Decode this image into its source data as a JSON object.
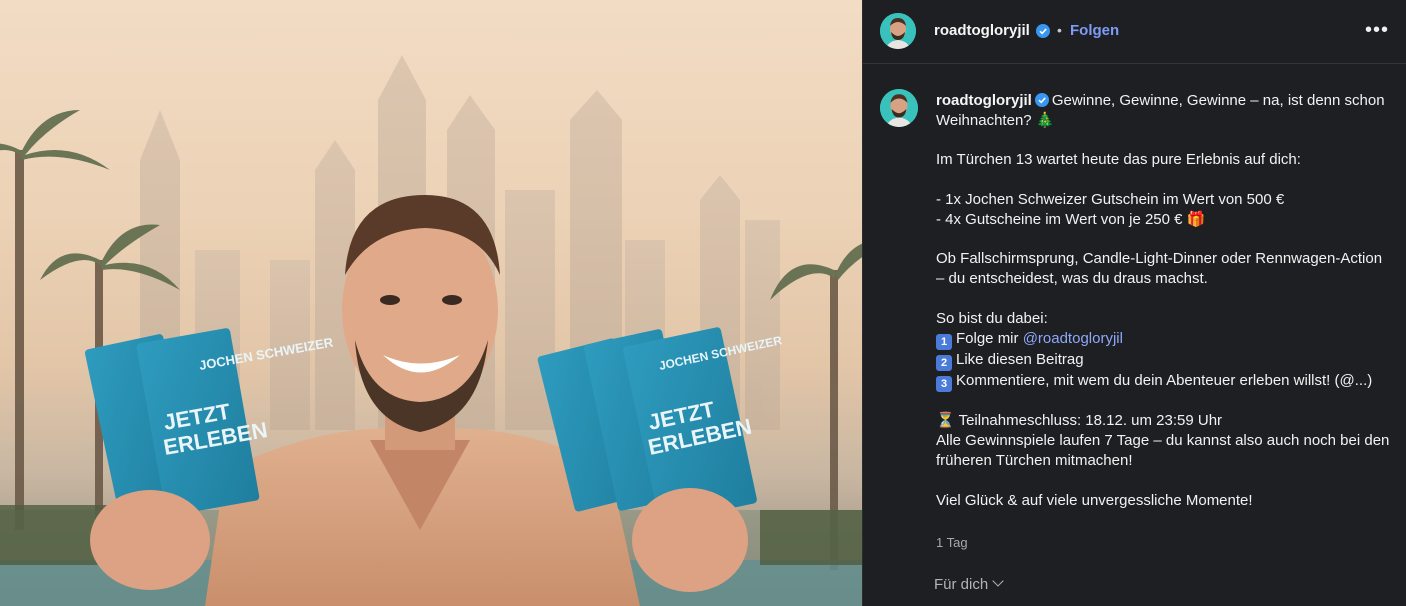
{
  "post": {
    "username": "roadtogloryjil",
    "follow_label": "Folgen",
    "separator": "•",
    "more_label": "•••",
    "verified_color": "#3897f0"
  },
  "caption": {
    "username": "roadtogloryjil",
    "line_1": "Gewinne, Gewinne, Gewinne – na, ist denn schon Weihnachten? 🎄",
    "line_2": "Im Türchen 13 wartet heute das pure Erlebnis auf dich:",
    "line_3": "- 1x Jochen Schweizer Gutschein im Wert von 500 €",
    "line_4": "- 4x Gutscheine im Wert von je 250 € 🎁",
    "line_5": "Ob Fallschirmsprung, Candle-Light-Dinner oder Rennwagen-Action – du entscheidest, was du draus machst.",
    "line_6": "So bist du dabei:",
    "step_1_badge": "1",
    "step_1_text": "Folge mir ",
    "step_1_mention": "@roadtogloryjil",
    "step_2_badge": "2",
    "step_2_text": "Like diesen Beitrag",
    "step_3_badge": "3",
    "step_3_text": "Kommentiere, mit wem du dein Abenteuer erleben willst! (@...)",
    "deadline": "⏳ Teilnahmeschluss: 18.12. um 23:59 Uhr",
    "line_7": "Alle Gewinnspiele laufen 7 Tage – du kannst also auch noch bei den früheren Türchen mitmachen!",
    "line_8": "Viel Glück & auf viele unvergessliche Momente!"
  },
  "time_ago": "1 Tag",
  "for_you_label": "Für dich",
  "photo": {
    "ticket_brand": "JOCHEN SCHWEIZER",
    "ticket_cta_1": "JETZT",
    "ticket_cta_2": "ERLEBEN"
  },
  "colors": {
    "accent_link": "#7f9cf5",
    "panel_bg": "#1e1f23",
    "ticket_blue": "#2a8fb0"
  }
}
